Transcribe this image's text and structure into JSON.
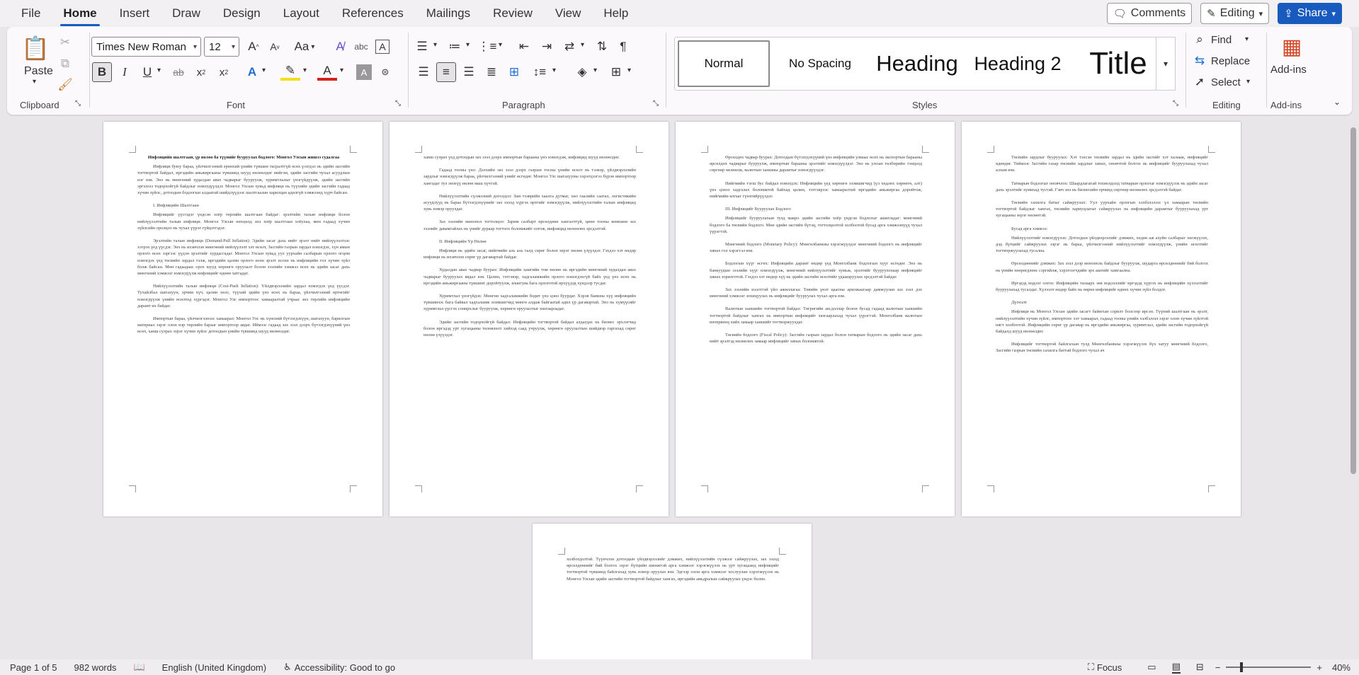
{
  "menu": {
    "items": [
      "File",
      "Home",
      "Insert",
      "Draw",
      "Design",
      "Layout",
      "References",
      "Mailings",
      "Review",
      "View",
      "Help"
    ],
    "active": "Home"
  },
  "top_right": {
    "comments": "Comments",
    "editing": "Editing",
    "share": "Share"
  },
  "ribbon": {
    "clipboard": {
      "paste": "Paste",
      "label": "Clipboard"
    },
    "font": {
      "name": "Times New Roman",
      "size": "12",
      "label": "Font",
      "case": "Aa"
    },
    "paragraph": {
      "label": "Paragraph"
    },
    "styles": {
      "label": "Styles",
      "items": [
        "Normal",
        "No Spacing",
        "Heading",
        "Heading 2",
        "Title"
      ],
      "selected": "Normal"
    },
    "editing": {
      "label": "Editing",
      "find": "Find",
      "replace": "Replace",
      "select": "Select"
    },
    "addins": {
      "label": "Add-ins",
      "button": "Add-ins"
    }
  },
  "document": {
    "page1": {
      "title": "Инфляцийн шалтгаан, үр нөлөө ба түүнийг бууруулах бодлого: Монгол Улсын жишээ судалгаа",
      "paras": [
        "Инфляци буюу бараа, үйлчилгээний ерөнхий үнийн түвшин тасралтгүй өсөх үзэгдэл нь эдийн засгийн тогтвортой байдал, иргэдийн амьжиргааны түвшинд шууд нөлөөлдөг нийгэм, эдийн засгийн чухал асуудлын нэг юм. Энэ нь мөнгөний худалдан авах чадварыг бууруулж, хуримтлалыг үнэгүйдүүлж, эдийн засгийн эргэлзээ тодорхойгүй байдлыг нэмэгдүүлдэг. Монгол Улсын хувьд инфляци нь түүхийн эдийн засгийн гадаад хүчин зүйлс, дотоодын бодлогын алдаатай шийдлүүдээс шалтгаалан харилцан адилгүй хэмжээнд хүрч байсан.",
        "I. Инфляцийн Шалтгаан",
        "Инфляцийг үүсгэдэг үндсэн хоёр төрлийн шалтгаан байдаг: эрэлтийн талын инфляци болон нийлүүлэлтийн талын инфляци. Монгол Улсын нөхцөлд энэ хоёр шалтгаан хоёулаа, мөн гадаад хүчин зүйлсийн оролцоо нь чухал үүрэг гүйцэтгэдэг.",
        "Эрэлтийн талын инфляци (Demand-Pull Inflation): Эдийн засаг дахь нийт эрэлт нийт нийлүүлэлтээс хэтрэх үед үүсдэг. Энэ нь ихэвчлэн мөнгөний нийлүүлэлт хэт өсөлт, Засгийн газрын зардал нэмэгдэх, хүн амын орлого өсөх зэргээс үүдэн эрэлтийг хурдасгадаг. Монгол Улсын хувьд уул уурхайн салбарын орлого огцом нэмэгдэх үед төсвийн зардал тэлж, иргэдийн цалин орлого өсөн эрэлт өссөн нь инфляцийн гол хүчин зүйл болж байсан. Мөн гадаадаас орох шууд хөрөнгө оруулалт болон зээлийн хэмжээ өсөх нь эдийн засаг дахь мөнгөний хэмжээг нэмэгдүүлж инфляцийг өдөөн хатгадаг.",
        "Нийлүүлэлтийн талын инфляци (Cost-Push Inflation): Үйлдвэрлэлийн зардал нэмэгдэх үед үүсдэг. Тухайлбал шатахуун, эрчим хүч, цалин хөлс, түүхий эдийн үнэ өсөх нь бараа, үйлчилгээний өртөгийг нэмэгдүүлж үнийн өсөлтөд хүргэдэг. Монгол Улс импортоос хамааралтай учраас энэ төрлийн инфляцийн дарамт их байдаг.",
        "Импортын бараа, үйлчилгээнээс хамаарал: Монгол Улс нь хүнсний бүтээгдэхүүн, шатахуун, барилгын материал зэрэг олон нэр төрлийн барааг импортоор авдаг. Иймээс гадаад зах зээл дээрх бүтээгдэхүүний үнэ өсөх, ханш сулрах зэрэг хүчин зүйлс дотоодын үнийн түвшинд шууд нөлөөлдөг."
      ]
    },
    "page2": {
      "paras": [
        "ханш сулрах үед дотоодын зах зээл дээрх импортын барааны үнэ нэмэгдэж, инфляцид шууд нөлөөлдөг.",
        "Гадаад тооны үнэ: Дэлхийн зах зээл дээрх газрын тосны үнийн өсөлт нь тээвэр, үйлдвэрлэлийн зардлыг нэмэгдүүлж бараа, үйлчилгээний үнийг өсгөдөг. Монгол Улс шатахууны хэрэгцээгээ бүрэн импортоор хангадаг тул энэхүү нөлөө маш хүчтэй.",
        "Нийлүүлэлтийн сүлжээний доголдол: Зам тээврийн хаалга дутмаг, хил гаалийн саатал, логистикийн асуудлууд нь бараа бүтээгдэхүүнийг зах зээлд хүргэх өртгийг нэмэгдүүлж, нийлүүлэлтийн талын инфляцид хувь нэмэр оруулдаг.",
        "Зах зээлийн мөнопол тогтолцоо: Зарим салбарт өрсөлдөөн хангалтгүй, цөөн тооны компани зах зээлийг давамгайлах нь үнийг дураар тогтоох боломжийг олгож, инфляцид нөлөөлөх эрсдэлтэй.",
        "II. Инфляцийн Үр Нөлөө",
        "Инфляци нь эдийн засаг, нийгмийн аль аль талд сөрөг болон эерэг нөлөө үзүүлдэг. Гэхдээ хэт өндөр инфляци нь ихэвчлэн сөрөг үр дагавартай байдаг.",
        "Худалдан авах чадвар буурах: Инфляцийн хамгийн том нөлөө нь иргэдийн мөнгөний худалдан авах чадварыг бууруулах явдал юм. Цалин, тэтгэвэр, хадгаламжийн орлого нэмэгдэхгүй байх үед үнэ өсөх нь иргэдийн амьжиргааны түвшинг доройтуулж, ялангуяа бага орлоготой өрхүүдэд хүндээр тусдаг.",
        "Хуримтлал үнэгүйдэх: Мөнгөн хадгаламжийн бодит үнэ цэнэ буурдаг. Хэрэв банкны хүү инфляцийн түвшинээс бага байвал хадгаламж эзэмшигчид мөнгө алдаж байгаатай адил үр дагавартай. Энэ нь хүмүүсийг хуримтлал үүсгэх сонирхлыг бууруулж, хөрөнгө оруулалтыг хязгаарладаг.",
        "Эдийн засгийн тодорхойгүй байдал: Инфляцийн тогтвортой байдал алдагдах нь бизнес эрхлэгчид болон иргэдэд урт хугацааны төлөвлөлт хийхэд саад учруулж, хөрөнгө оруулалтын шийдвэр гаргахад сөрөг нөлөө үзүүлдэг."
      ]
    },
    "page3": {
      "paras": [
        "Өрсөлдөх чадвар буурах: Дотоодын бүтээгдэхүүний үнэ инфляцийн улмаас өсөх нь экспортын барааны өрсөлдөх чадварыг бууруулж, импортын барааны эрэлтийг нэмэгдүүлдэг. Энэ нь улсын төлбөрийн тэнцэлд сөргөөр нөлөөлж, валютын ханшны дарамтыг нэмэгдүүлдэг.",
        "Нийгмийн тэгш бус байдал нэмэгдэх: Инфляцийн үед хөрөнгө эзэмшигчид (үл хөдлөх хөрөнгө, алт) үнэ цэнээ хадгалах боломжтой байхад цалин, тэтгэврээс хамааралтай иргэдийн амьжиргаа доройтож, нийгмийн ялгааг гүнзгийрүүлдэг.",
        "III. Инфляцийг Бууруулах Бодлого",
        "Инфляцийг бууруулахын тулд макро эдийн засгийн хоёр үндсэн бодлогыг ашигладаг: мөнгөний бодлого ба төсвийн бодлого. Мөн эдийн засгийн бүтэц, тогтолцоотой холбоотой бусад арга хэмжээнүүд чухал үүрэгтэй.",
        "Мөнгөний бодлого (Monetary Policy): Мөнгөлбанкны хэрэгжүүлдэг мөнгөний бодлого нь инфляцийг хянах гол хэрэгсэл юм.",
        "Бодлогын хүүг өсгөх: Инфляцийн дарамт өндөр үед Монголбанк бодлогын хүүг өсгөдөг. Энэ нь банкуудын зээлийн хүүг нэмэгдүүлж, мөнгөний нийлүүлэлтийг хумьж, эрэлтийг бууруулснаар инфляцийг хянах зорилготой. Гэхдээ хэт өндөр хүү нь эдийн засгийн өсөлтийг удаашруулах эрсдэлтэй байдаг.",
        "Зах зээлийн нээлттэй үйл ажиллагаа: Төвийн үнэт цаасны арилжаагаар дамжуулан зах зээл дэх мөнгөний хэмжээг зохицуулах нь инфляцийг бууруулах чухал арга юм.",
        "Валютын ханшийн тогтвортой байдал: Төгрөгийн ам.доллар болон бусад гадаад валютын ханшийн тогтвортой байдлыг хангах нь импортын инфляцийг хязгаарлахад чухал үүрэгтэй. Монголбанк валютын интервенц хийх замаар ханшийг тогтворжуулдаг.",
        "Төсвийн бодлого (Fiscal Policy): Засгийн газрын зардал болон татварын бодлого нь эдийн засаг дахь нийт эрэлтэд нөлөөлөх замаар инфляцийг хянах боломжтой."
      ]
    },
    "page4": {
      "paras": [
        "Төсвийн зардлыг бууруулах: Хэт тэлсэн төсвийн зардал нь эдийн засгийг хэт халааж, инфляцийг өдөөдөг. Тиймээс Засгийн газар төсвийн зардлыг хянах, оновчтой болгох нь инфляцийг бууруулахад чухал алхам юм.",
        "Татварын бодлогыг оновчлох: Шаардлагатай тохиолдолд татварын орлогыг нэмэгдүүлэх нь эдийн засаг дахь эрэлтийг хумихад тустай. Гэвч энэ нь бизнесийн орчинд сөргөөр нөлөөлөх эрсдэлтэй байдаг.",
        "Төсвийн сахилга батыг сайжруулах: Уул уурхайн орлогын хэлбэлзлээс үл хамааран төсвийн тогтвортой байдлыг хангах, төсвийн хариуцлагыг сайжруулах нь инфляцийн дарамтыг бууруулахад урт хугацааны эерэг нөлөөтэй.",
        "Бусад арга хэмжээ:",
        "Нийлүүлэлтийг нэмэгдүүлэх: Дотоодын үйлдвэрлэлийг дэмжих, хөдөө аж ахуйн салбарыг хөгжүүлэх, дэд бүтцийг сайжруулах зэрэг нь бараа, үйлчилгээний нийлүүлэлтийг нэмэгдүүлж, үнийн өсөлтийг тогтворжуулахад тусална.",
        "Өрсөлдөөнийг дэмжих: Зах зээл дээр монополь байдлыг бууруулж, шударга өрсөлдөөнийг бий болгох нь үнийн хөөрөгдлөөс сэргийлж, хэрэглэгчдийн эрх ашгийг хамгаална.",
        "Иргэдэд мэдлэг олгох: Инфляцийн талаарх зөв мэдээллийг иргэдэд хүргэх нь инфляцийн хүлээлтийг бууруулахад тусалдаг. Хүлээлт өндөр байх нь өөрөө инфляцийг өдөөх хүчин зүйл болдог.",
        "Дүгнэлт",
        "Инфляци нь Монгол Улсын эдийн засагт байнгын сорилт болсоор ирсэн. Түүний шалтгаан нь эрэлт, нийлүүлэлтийн хүчин зүйлс, импортоос хэт хамаарал, гадаад тооны үнийн хэлбэлзэл зэрэг олон хүчин зүйлтэй нягт холбоотой. Инфляцийн сөрөг үр дагавар нь иргэдийн амьжиргаа, хуримтлал, эдийн засгийн тодорхойгүй байдалд шууд нөлөөлдөг.",
        "Инфляцийг тогтвортой байлгахын тулд Мөнгөлбанкны хэрэгжүүлэх бүх хатуу мөнгөний бодлого, Засгийн газрын төсвийн сахилга баттай бодлого чухал ач"
      ]
    },
    "page5": {
      "paras": [
        "холбогдолтой. Түүнчлэн дотоодын үйлдвэрлэлийг дэмжих, нийлүүлэлтийн сүлжээг сайжруулах, зах зээлд өрсөлдөөнийг бий болгох зэрэг бүтцийн шинжтэй арга хэмжээг хэрэгжүүлэх нь урт хугацаанд инфляцийг тогтвортой түвшинд байлгахад хувь нэмэр оруулах юм. Эдгээр олон арга хэмжээг хослуулан хэрэгжүүлэх нь Монгол Улсын эдийн засгийн тогтвортой байдлыг хангах, иргэдийн амьдралын сайжруулах үндэс болно."
      ]
    }
  },
  "status": {
    "page": "Page 1 of 5",
    "words": "982 words",
    "language": "English (United Kingdom)",
    "accessibility": "Accessibility: Good to go",
    "focus": "Focus",
    "zoom": "40%"
  }
}
